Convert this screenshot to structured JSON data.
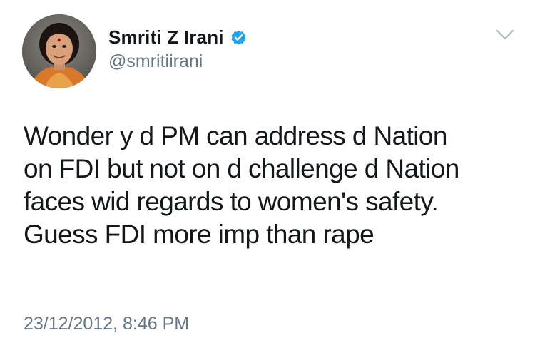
{
  "tweet": {
    "author": {
      "display_name": "Smriti Z Irani",
      "handle": "@smritiirani",
      "verified": true
    },
    "text_lines": [
      "Wonder y d PM can address d Nation",
      "on FDI but not on d challenge d Nation",
      "faces wid regards to women's safety.",
      "Guess FDI more imp than rape"
    ],
    "timestamp": "23/12/2012, 8:46 PM"
  },
  "icons": {
    "verified": "verified-badge-icon",
    "menu": "chevron-down-icon"
  },
  "colors": {
    "text_primary": "#14171a",
    "text_secondary": "#657786",
    "verified_blue": "#1da1f2",
    "chevron": "#aab8c2"
  }
}
